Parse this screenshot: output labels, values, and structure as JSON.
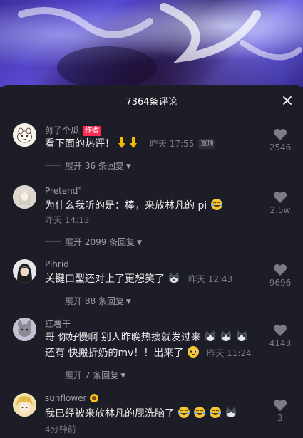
{
  "header": {
    "title": "7364条评论"
  },
  "comments": [
    {
      "username": "剪了个瓜",
      "badge": "作者",
      "text": "看下面的热评！",
      "time": "昨天 17:55",
      "tag": "置顶",
      "likes": "2546",
      "replies": "展开 36 条回复"
    },
    {
      "username": "Pretend°",
      "text": "为什么我听的是：棒，来放林凡的 pi",
      "time": "昨天 14:13",
      "likes": "2.5w",
      "replies": "展开 2099 条回复"
    },
    {
      "username": "Pihrid",
      "text": "关键口型还对上了更想笑了",
      "time": "昨天 12:43",
      "likes": "9696",
      "replies": "展开 88 条回复"
    },
    {
      "username": "红薯干",
      "text_line1": "哥 你好慢啊 别人昨晚热搜就发过来",
      "text_line2": "还有 快搬折奶的mv！！出来了",
      "time": "昨天 11:24",
      "likes": "4143",
      "replies": "展开 7 条回复"
    },
    {
      "username": "sunflower",
      "text": "我已经被来放林凡的屁洗脑了",
      "time": "4分钟前",
      "likes": "3"
    }
  ],
  "colors": {
    "panel": "#1c1d26",
    "badge": "#fe2c55",
    "muted": "#7a7b84"
  }
}
